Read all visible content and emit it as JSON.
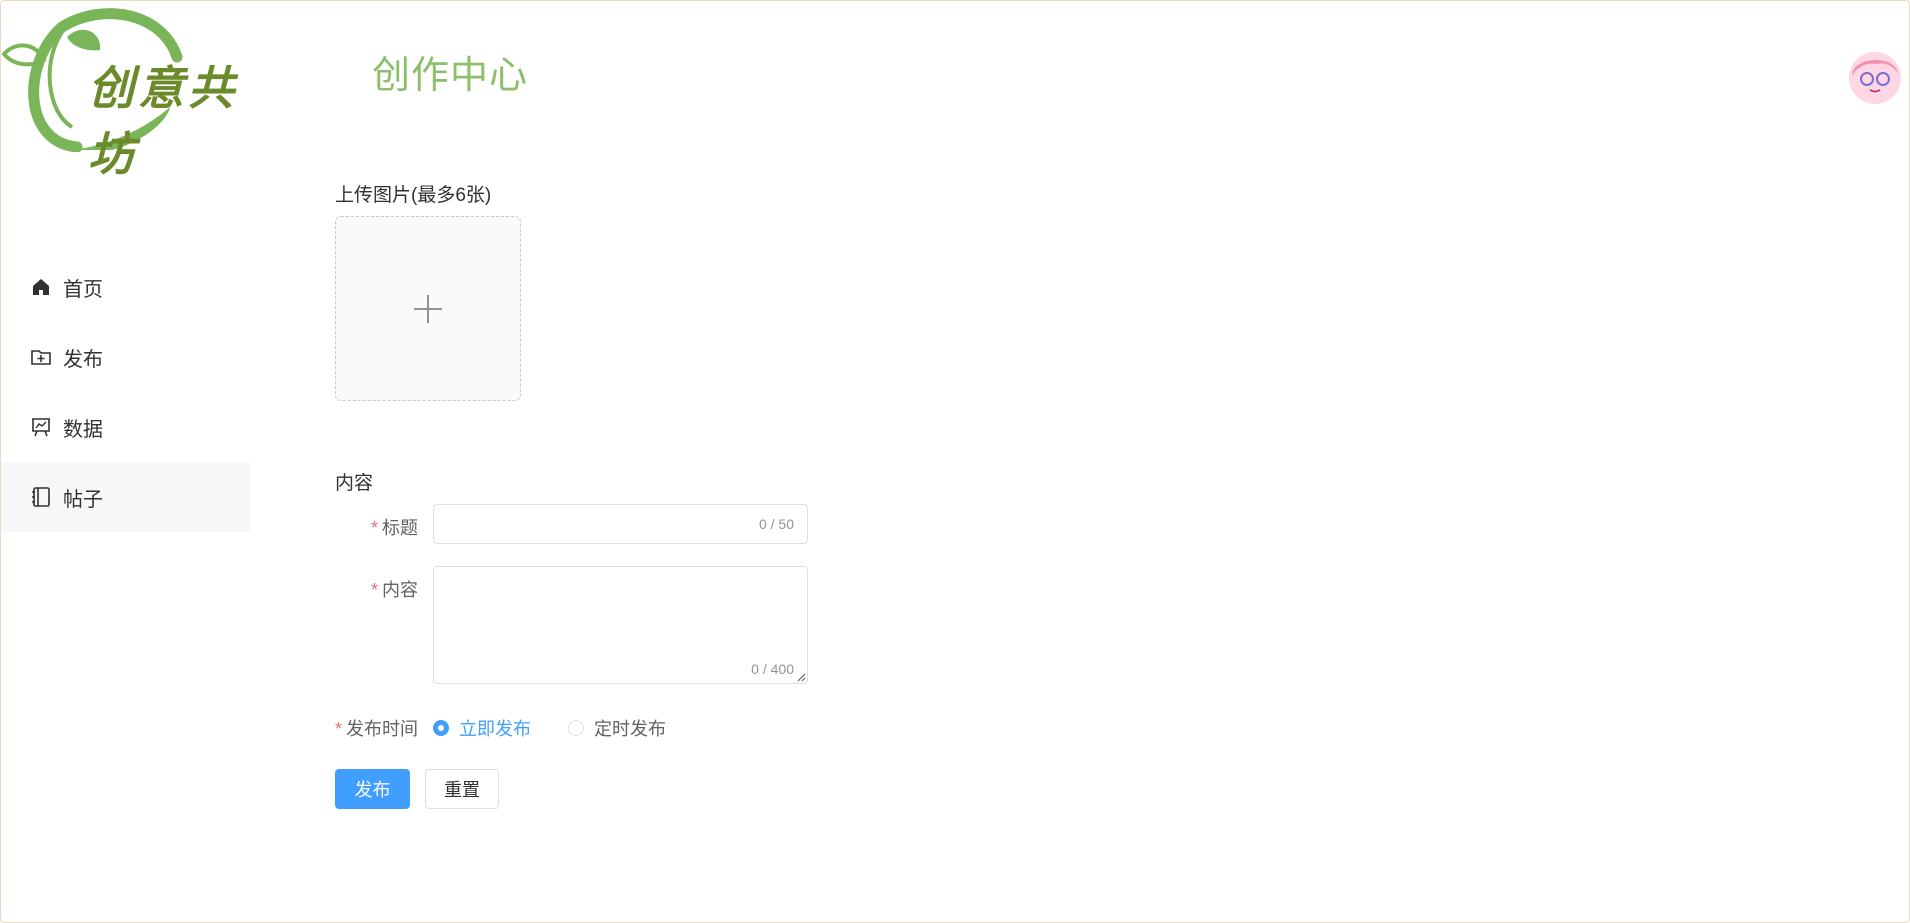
{
  "header": {
    "logo_text": "创意共坊",
    "page_title": "创作中心",
    "avatar_alt": "user-avatar"
  },
  "sidebar": {
    "items": [
      {
        "label": "首页",
        "icon": "home-icon"
      },
      {
        "label": "发布",
        "icon": "folder-add-icon"
      },
      {
        "label": "数据",
        "icon": "chart-board-icon"
      },
      {
        "label": "帖子",
        "icon": "notebook-icon",
        "active": true
      }
    ]
  },
  "form": {
    "upload_label": "上传图片(最多6张)",
    "content_section_label": "内容",
    "title_label": "标题",
    "title_count": "0 / 50",
    "title_value": "",
    "content_label": "内容",
    "content_count": "0 / 400",
    "content_value": "",
    "publish_time_label": "发布时间",
    "radio_now": "立即发布",
    "radio_scheduled": "定时发布",
    "selected_option": "立即发布",
    "submit_label": "发布",
    "reset_label": "重置"
  },
  "colors": {
    "primary": "#409eff",
    "brand_green": "#8cbf6a",
    "required": "#f56c6c"
  }
}
